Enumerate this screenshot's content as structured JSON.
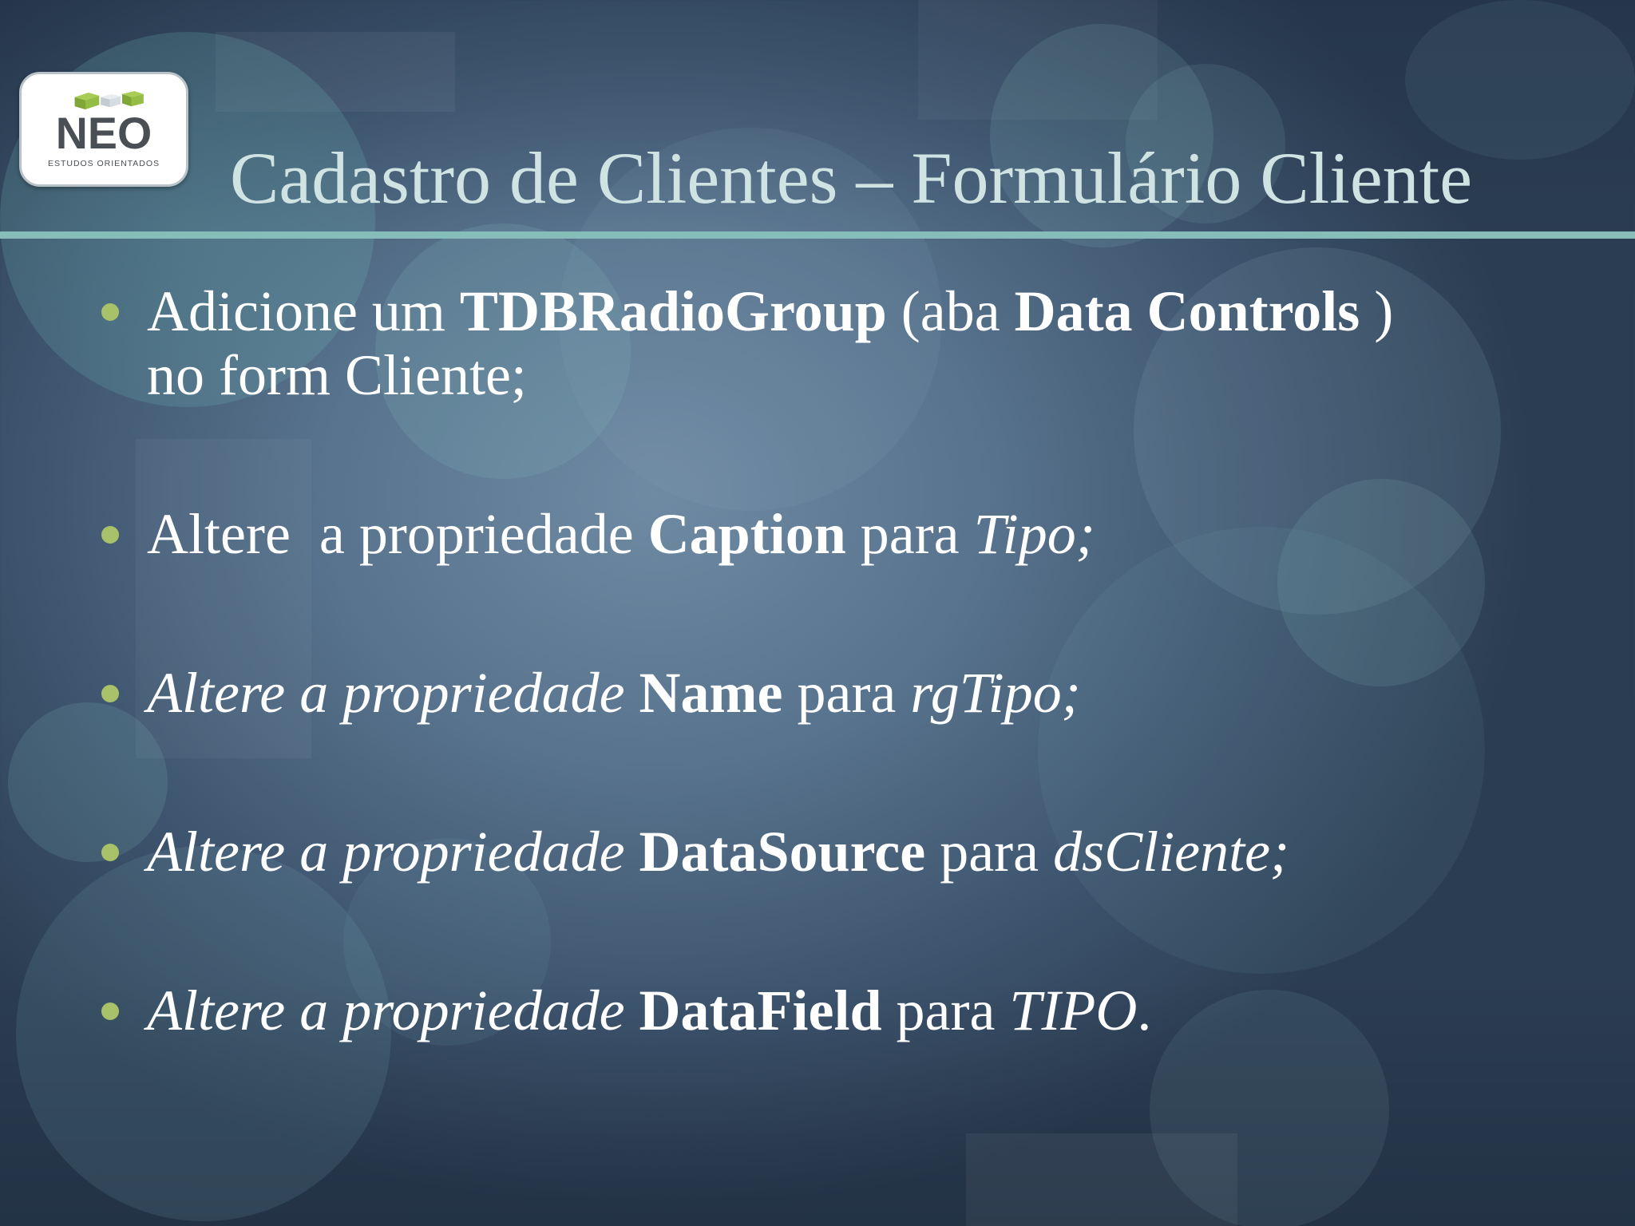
{
  "slide": {
    "title": "Cadastro de Clientes – Formulário Cliente",
    "logo": {
      "brand": "NEO",
      "tagline": "ESTUDOS ORIENTADOS"
    },
    "bullets": [
      {
        "segments": [
          {
            "text": "Adicione um ",
            "style": "normal"
          },
          {
            "text": "TDBRadioGroup",
            "style": "bold"
          },
          {
            "text": " (aba ",
            "style": "normal"
          },
          {
            "text": "Data Controls ",
            "style": "bold"
          },
          {
            "text": ")",
            "style": "normal"
          },
          {
            "text": "no form Cliente;",
            "style": "normal"
          }
        ]
      },
      {
        "segments": [
          {
            "text": "Altere  a propriedade ",
            "style": "normal"
          },
          {
            "text": "Caption",
            "style": "bold"
          },
          {
            "text": " para ",
            "style": "normal"
          },
          {
            "text": "Tipo;",
            "style": "italic"
          }
        ]
      },
      {
        "segments": [
          {
            "text": "Altere a propriedade ",
            "style": "italic"
          },
          {
            "text": "Name",
            "style": "bold"
          },
          {
            "text": " para ",
            "style": "normal"
          },
          {
            "text": "rgTipo;",
            "style": "italic"
          }
        ]
      },
      {
        "segments": [
          {
            "text": "Altere a propriedade ",
            "style": "italic"
          },
          {
            "text": "DataSource",
            "style": "bold"
          },
          {
            "text": " para ",
            "style": "normal"
          },
          {
            "text": "dsCliente;",
            "style": "italic"
          }
        ]
      },
      {
        "segments": [
          {
            "text": "Altere a propriedade ",
            "style": "italic"
          },
          {
            "text": "DataField",
            "style": "bold"
          },
          {
            "text": " para ",
            "style": "normal"
          },
          {
            "text": "TIPO",
            "style": "italic"
          },
          {
            "text": ".",
            "style": "normal"
          }
        ]
      }
    ]
  },
  "colors": {
    "title": "#cfe3e3",
    "rule": "#86bdb8",
    "bullet_dot": "#a9c26a",
    "body_text": "#ffffff",
    "logo_green": "#8cb43c",
    "logo_text": "#4a4f55"
  }
}
